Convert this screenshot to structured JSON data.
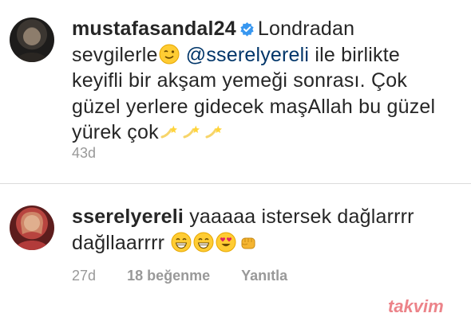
{
  "post": {
    "username": "mustafasandal24",
    "text_line1_a": "Londradan",
    "text_line2_a": "sevgilerle",
    "mention": "@sserelyereli",
    "text_line2_b": "ile birlikte",
    "text_line3": "keyifli bir akşam yemeği sonrası. Çok",
    "text_line4": "güzel yerlere gidecek maşAllah bu güzel",
    "text_line5": "yürek çok",
    "time": "43d"
  },
  "reply": {
    "username": "sserelyereli",
    "text_a": "yaaaaa istersek dağlarrrr",
    "text_b": "dağllaarrrr",
    "time": "27d",
    "likes": "18 beğenme",
    "reply_label": "Yanıtla"
  },
  "watermark": {
    "text": "takvim"
  },
  "colors": {
    "text": "#262626",
    "mention": "#003569",
    "meta": "#999999",
    "verified": "#3897f0"
  },
  "icons": [
    "verified-badge-icon",
    "wink-emoji-icon",
    "dizzy-emoji-icon",
    "grin-emoji-icon",
    "heart-eyes-emoji-icon",
    "fist-emoji-icon"
  ]
}
